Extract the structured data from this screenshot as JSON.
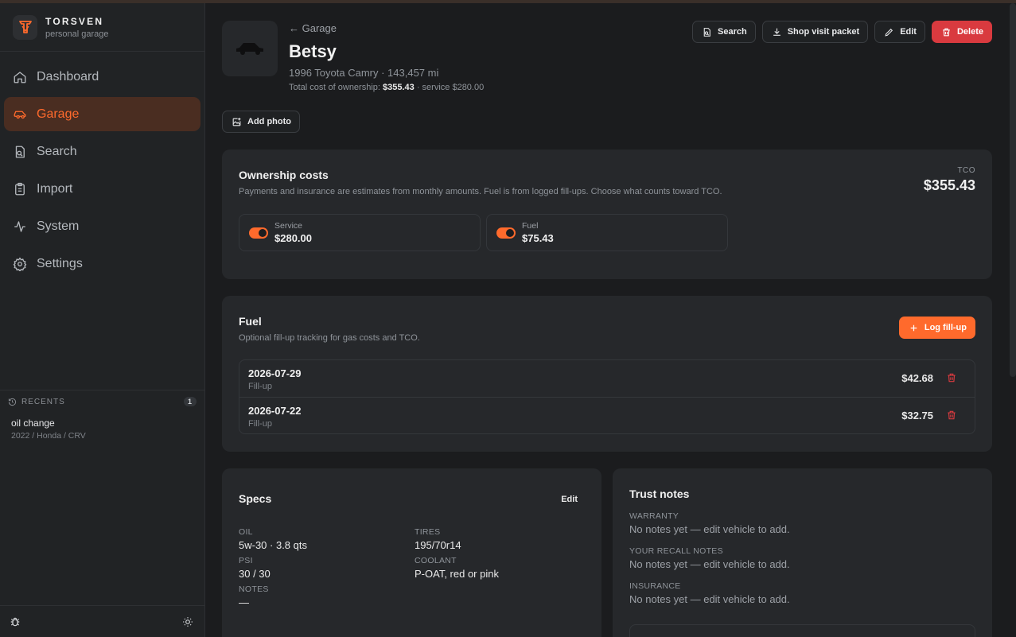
{
  "app": {
    "name": "TORSVEN",
    "subtitle": "personal garage"
  },
  "nav": [
    {
      "label": "Dashboard",
      "icon": "home-icon"
    },
    {
      "label": "Garage",
      "icon": "car-icon",
      "active": true
    },
    {
      "label": "Search",
      "icon": "search-icon"
    },
    {
      "label": "Import",
      "icon": "clipboard-icon"
    },
    {
      "label": "System",
      "icon": "activity-icon"
    },
    {
      "label": "Settings",
      "icon": "gear-icon"
    }
  ],
  "recents": {
    "label": "RECENTS",
    "count": "1",
    "items": [
      {
        "title": "oil change",
        "sub": "2022 / Honda / CRV"
      }
    ]
  },
  "vehicle": {
    "back": "Garage",
    "name": "Betsy",
    "sub": "1996 Toyota Camry · 143,457 mi",
    "tco_prefix": "Total cost of ownership: ",
    "tco_value": "$355.43",
    "tco_suffix": " · service $280.00"
  },
  "actions": {
    "search": "Search",
    "packet": "Shop visit packet",
    "edit": "Edit",
    "delete": "Delete",
    "add_photo": "Add photo"
  },
  "costs": {
    "title": "Ownership costs",
    "desc": "Payments and insurance are estimates from monthly amounts. Fuel is from logged fill-ups. Choose what counts toward TCO.",
    "tco_label": "TCO",
    "tco_value": "$355.43",
    "toggles": [
      {
        "label": "Service",
        "value": "$280.00",
        "on": true
      },
      {
        "label": "Fuel",
        "value": "$75.43",
        "on": true
      }
    ]
  },
  "fuel": {
    "title": "Fuel",
    "desc": "Optional fill-up tracking for gas costs and TCO.",
    "log_label": "Log fill-up",
    "rows": [
      {
        "date": "2026-07-29",
        "type": "Fill-up",
        "amount": "$42.68"
      },
      {
        "date": "2026-07-22",
        "type": "Fill-up",
        "amount": "$32.75"
      }
    ]
  },
  "specs": {
    "title": "Specs",
    "edit": "Edit",
    "items": [
      {
        "label": "OIL",
        "value": "5w-30 · 3.8 qts"
      },
      {
        "label": "TIRES",
        "value": "195/70r14"
      },
      {
        "label": "PSI",
        "value": "30 / 30"
      },
      {
        "label": "COOLANT",
        "value": "P-OAT, red or pink"
      },
      {
        "label": "NOTES",
        "value": "—"
      }
    ]
  },
  "trust": {
    "title": "Trust notes",
    "items": [
      {
        "label": "WARRANTY",
        "value": "No notes yet — edit vehicle to add."
      },
      {
        "label": "YOUR RECALL NOTES",
        "value": "No notes yet — edit vehicle to add."
      },
      {
        "label": "INSURANCE",
        "value": "No notes yet — edit vehicle to add."
      }
    ]
  },
  "colors": {
    "accent": "#ff6a2c",
    "danger": "#d93a3f",
    "bg": "#1b1c1e",
    "card": "#26282b"
  }
}
